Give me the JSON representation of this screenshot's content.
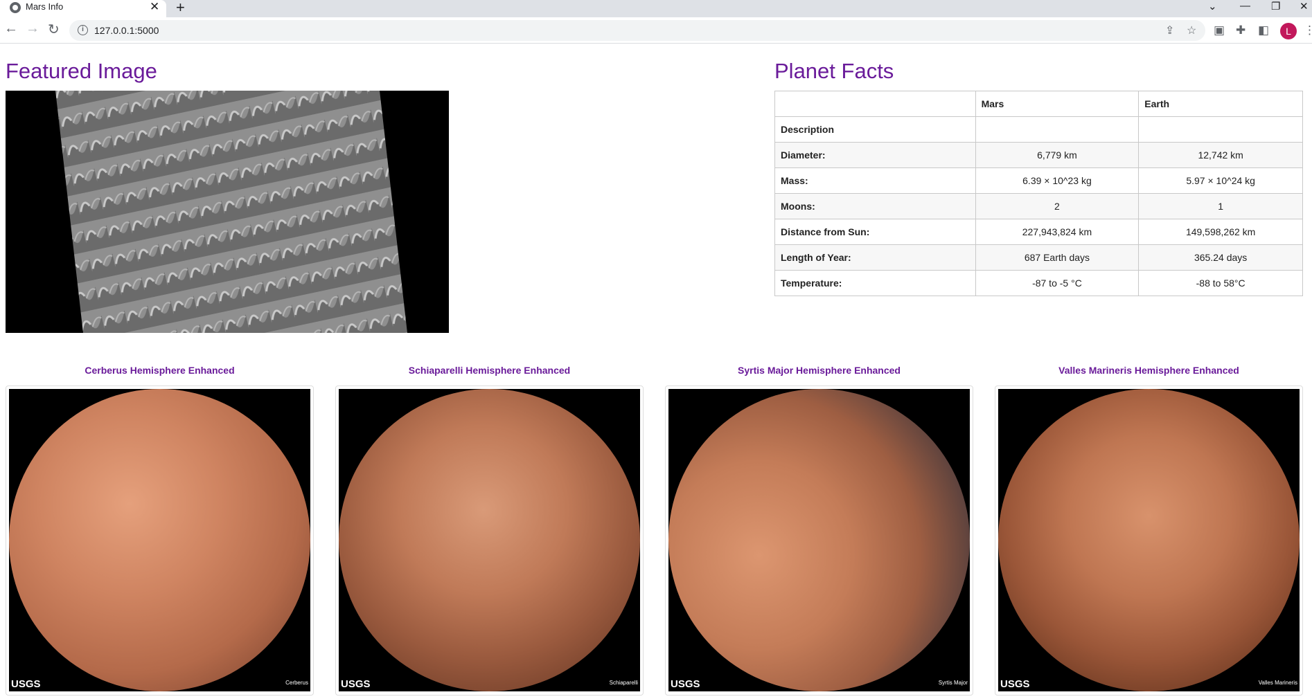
{
  "browser": {
    "tab_title": "Mars Info",
    "url": "127.0.0.1:5000",
    "profile_initial": "L"
  },
  "featured": {
    "heading": "Featured Image"
  },
  "facts": {
    "heading": "Planet Facts",
    "columns": [
      "",
      "Mars",
      "Earth"
    ],
    "rows": [
      {
        "label": "Description",
        "mars": "",
        "earth": ""
      },
      {
        "label": "Diameter:",
        "mars": "6,779 km",
        "earth": "12,742 km"
      },
      {
        "label": "Mass:",
        "mars": "6.39 × 10^23 kg",
        "earth": "5.97 × 10^24 kg"
      },
      {
        "label": "Moons:",
        "mars": "2",
        "earth": "1"
      },
      {
        "label": "Distance from Sun:",
        "mars": "227,943,824 km",
        "earth": "149,598,262 km"
      },
      {
        "label": "Length of Year:",
        "mars": "687 Earth days",
        "earth": "365.24 days"
      },
      {
        "label": "Temperature:",
        "mars": "-87 to -5 °C",
        "earth": "-88 to 58°C"
      }
    ]
  },
  "hemispheres": [
    {
      "title": "Cerberus Hemisphere Enhanced",
      "logo": "USGS",
      "caption": "Cerberus"
    },
    {
      "title": "Schiaparelli Hemisphere Enhanced",
      "logo": "USGS",
      "caption": "Schiaparelli"
    },
    {
      "title": "Syrtis Major Hemisphere Enhanced",
      "logo": "USGS",
      "caption": "Syrtis Major"
    },
    {
      "title": "Valles Marineris Hemisphere Enhanced",
      "logo": "USGS",
      "caption": "Valles Marineris"
    }
  ]
}
